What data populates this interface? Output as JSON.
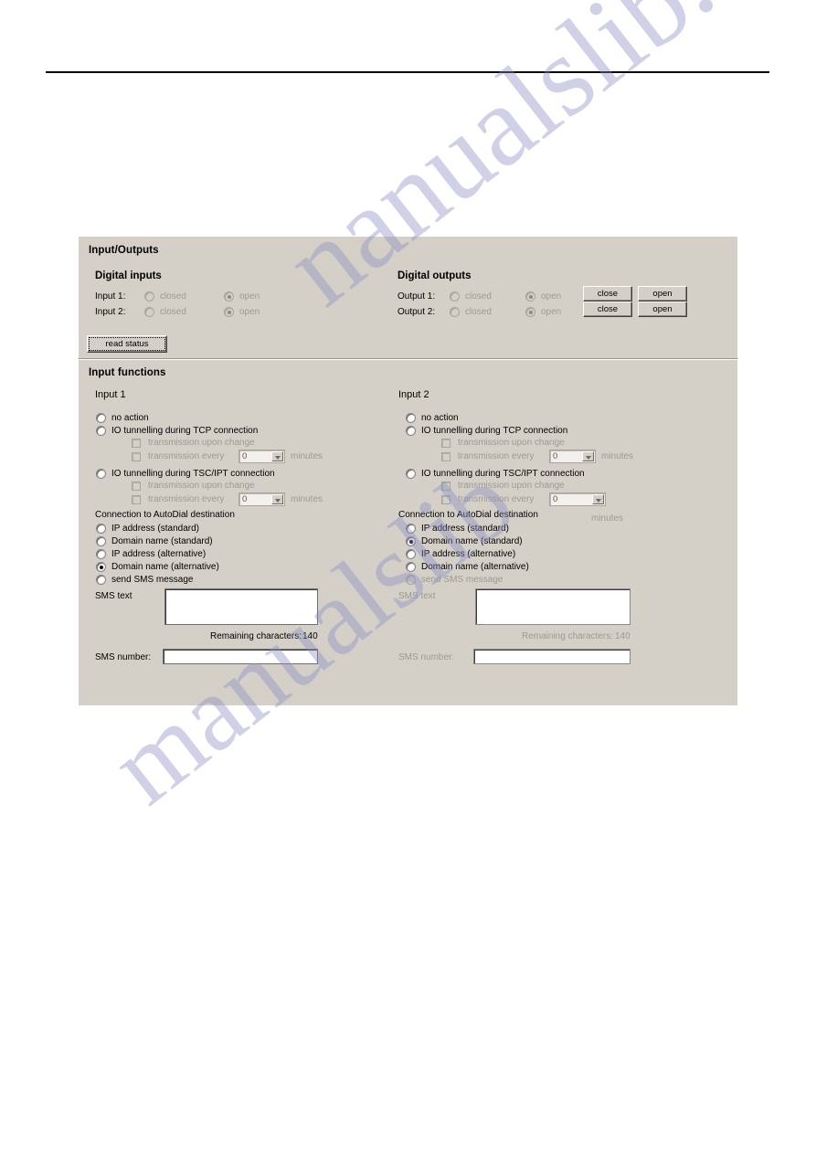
{
  "io_panel": {
    "title": "Input/Outputs",
    "digital_inputs": {
      "title": "Digital inputs",
      "rows": [
        {
          "label": "Input 1:",
          "closed_label": "closed",
          "open_label": "open",
          "state": "open"
        },
        {
          "label": "Input 2:",
          "closed_label": "closed",
          "open_label": "open",
          "state": "open"
        }
      ]
    },
    "digital_outputs": {
      "title": "Digital outputs",
      "rows": [
        {
          "label": "Output 1:",
          "closed_label": "closed",
          "open_label": "open",
          "state": "open",
          "close_button": "close",
          "open_button": "open"
        },
        {
          "label": "Output 2:",
          "closed_label": "closed",
          "open_label": "open",
          "state": "open",
          "close_button": "close",
          "open_button": "open"
        }
      ]
    },
    "read_status_button": "read status"
  },
  "functions_panel": {
    "title": "Input functions",
    "inputs": [
      {
        "heading": "Input 1",
        "mode_options": [
          {
            "label": "no action",
            "selected": false
          },
          {
            "label": "IO tunnelling during TCP connection",
            "selected": false
          },
          {
            "label": "IO tunnelling during TSC/IPT connection",
            "selected": false
          }
        ],
        "tcp_sub": {
          "upon_change_label": "transmission upon change",
          "every_label": "transmission every",
          "interval_value": "0",
          "minutes_label": "minutes"
        },
        "tsc_sub": {
          "upon_change_label": "transmission upon change",
          "every_label": "transmission every",
          "interval_value": "0",
          "minutes_label": "minutes"
        },
        "autodial": {
          "heading": "Connection to AutoDial destination",
          "options": [
            {
              "label": "IP address (standard)",
              "selected": false
            },
            {
              "label": "Domain name (standard)",
              "selected": false
            },
            {
              "label": "IP address (alternative)",
              "selected": false
            },
            {
              "label": "Domain name (alternative)",
              "selected": true
            },
            {
              "label": "send SMS message",
              "selected": false
            }
          ]
        },
        "sms": {
          "text_label": "SMS text",
          "text_value": "",
          "remaining_label": "Remaining characters:",
          "remaining_count": "140",
          "number_label": "SMS number:",
          "number_value": "",
          "disabled": false
        }
      },
      {
        "heading": "Input 2",
        "mode_options": [
          {
            "label": "no action",
            "selected": false
          },
          {
            "label": "IO tunnelling during TCP connection",
            "selected": false
          },
          {
            "label": "IO tunnelling during TSC/IPT connection",
            "selected": false
          }
        ],
        "tcp_sub": {
          "upon_change_label": "transmission upon change",
          "every_label": "transmission every",
          "interval_value": "0",
          "minutes_label": "minutes"
        },
        "tsc_sub": {
          "upon_change_label": "transmission upon change",
          "every_label": "transmission every",
          "interval_value": "0",
          "minutes_label": "minutes"
        },
        "autodial": {
          "heading": "Connection to AutoDial destination",
          "options": [
            {
              "label": "IP address (standard)",
              "selected": false
            },
            {
              "label": "Domain name (standard)",
              "selected": true
            },
            {
              "label": "IP address (alternative)",
              "selected": false
            },
            {
              "label": "Domain name (alternative)",
              "selected": false
            },
            {
              "label": "send SMS message",
              "selected": false
            }
          ]
        },
        "sms": {
          "text_label": "SMS text",
          "text_value": "",
          "remaining_label": "Remaining characters:",
          "remaining_count": "140",
          "number_label": "SMS number:",
          "number_value": "",
          "disabled": true
        }
      }
    ]
  },
  "watermark": {
    "line_a": "nanualslib.com",
    "line_b": "manualslib"
  }
}
